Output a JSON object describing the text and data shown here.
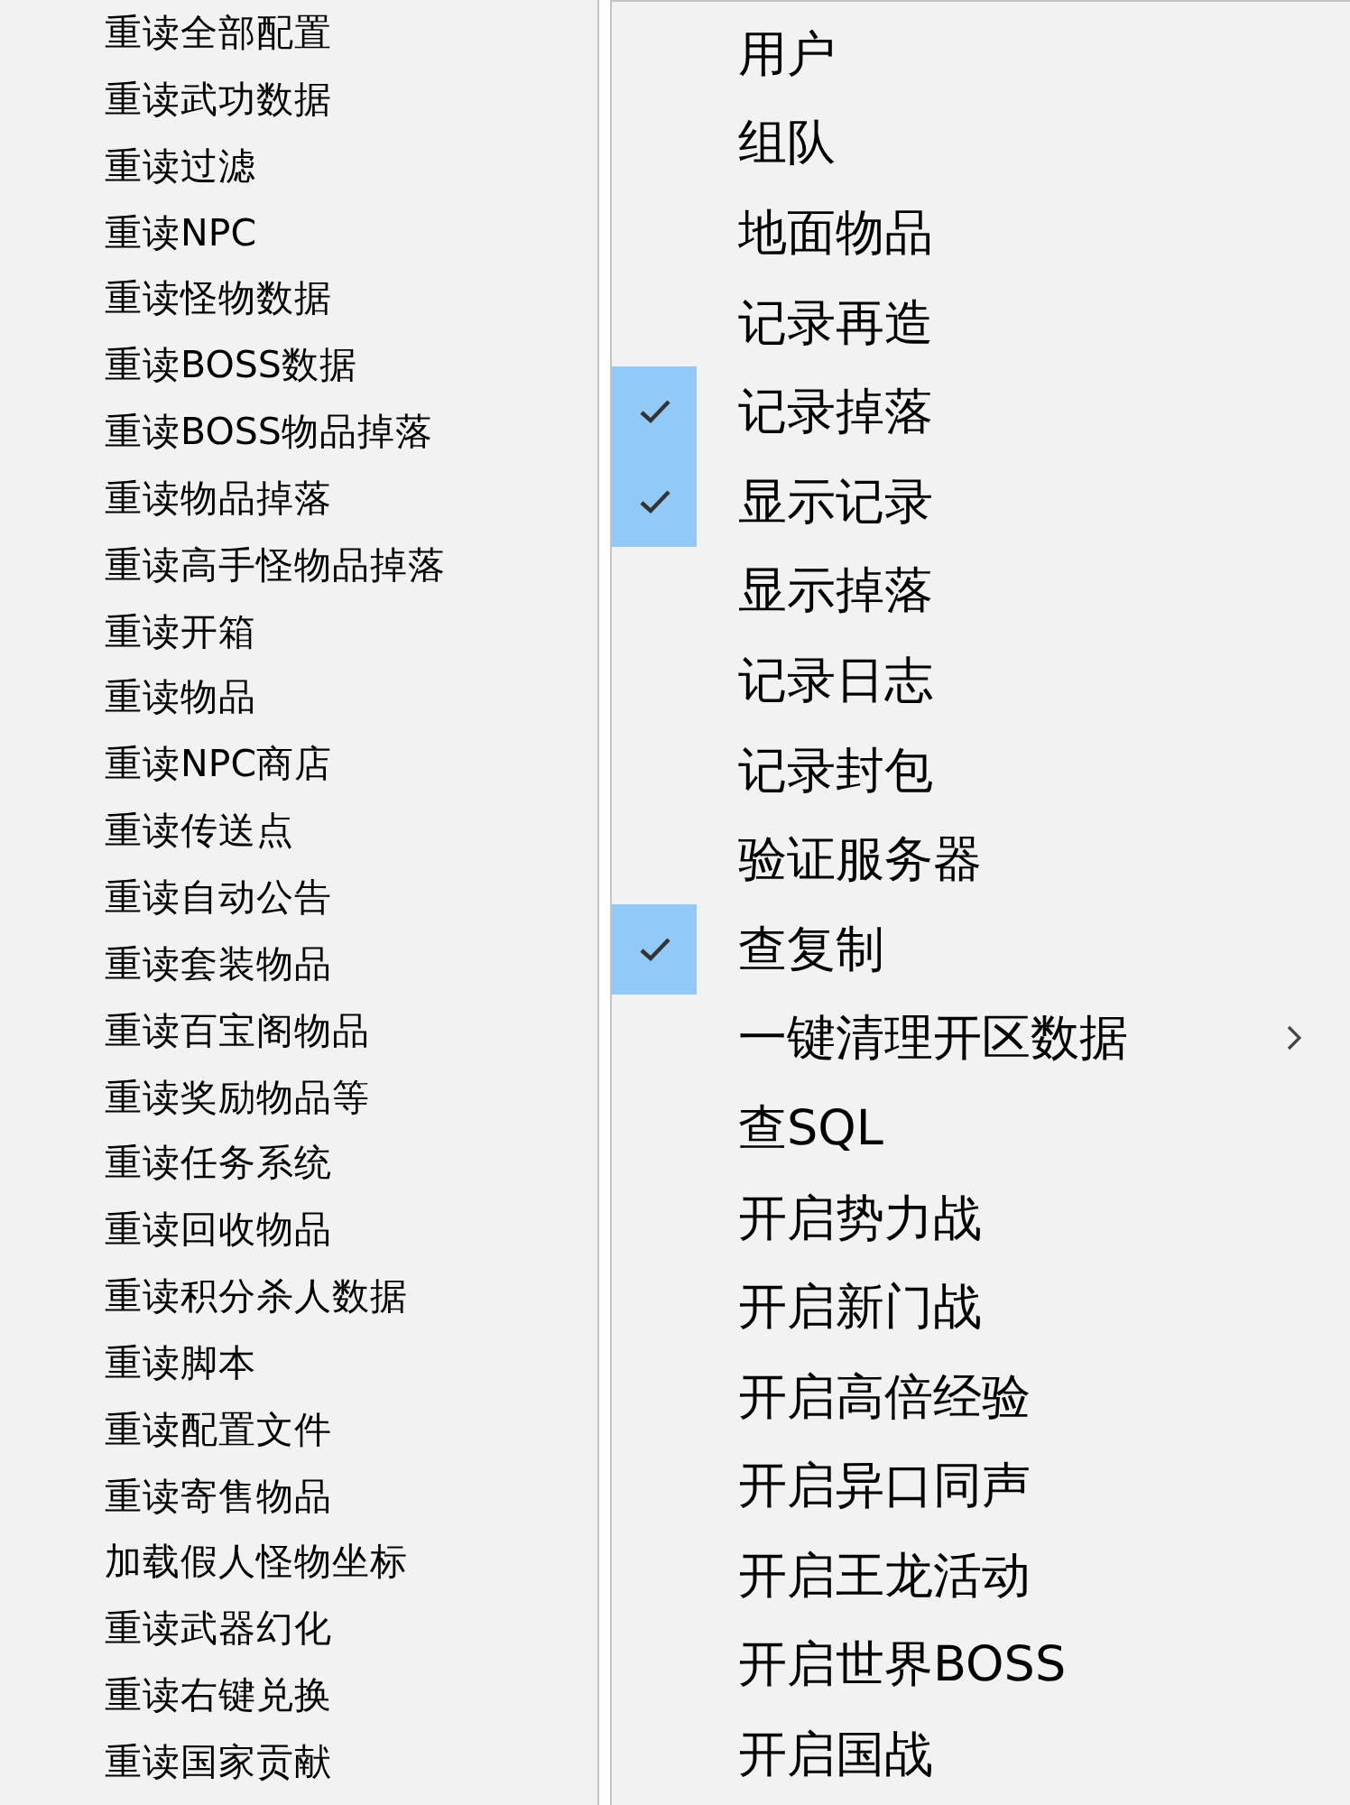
{
  "left_menu": {
    "items": [
      {
        "label": "重读全部配置"
      },
      {
        "label": "重读武功数据"
      },
      {
        "label": "重读过滤"
      },
      {
        "label": "重读NPC"
      },
      {
        "label": "重读怪物数据"
      },
      {
        "label": "重读BOSS数据"
      },
      {
        "label": "重读BOSS物品掉落"
      },
      {
        "label": "重读物品掉落"
      },
      {
        "label": "重读高手怪物品掉落"
      },
      {
        "label": "重读开箱"
      },
      {
        "label": "重读物品"
      },
      {
        "label": "重读NPC商店"
      },
      {
        "label": "重读传送点"
      },
      {
        "label": "重读自动公告"
      },
      {
        "label": "重读套装物品"
      },
      {
        "label": "重读百宝阁物品"
      },
      {
        "label": "重读奖励物品等"
      },
      {
        "label": "重读任务系统"
      },
      {
        "label": "重读回收物品"
      },
      {
        "label": "重读积分杀人数据"
      },
      {
        "label": "重读脚本"
      },
      {
        "label": "重读配置文件"
      },
      {
        "label": "重读寄售物品"
      },
      {
        "label": "加载假人怪物坐标"
      },
      {
        "label": "重读武器幻化"
      },
      {
        "label": "重读右键兑换"
      },
      {
        "label": "重读国家贡献"
      }
    ]
  },
  "right_menu": {
    "items": [
      {
        "label": "用户",
        "checked": false,
        "submenu": false
      },
      {
        "label": "组队",
        "checked": false,
        "submenu": false
      },
      {
        "label": "地面物品",
        "checked": false,
        "submenu": false
      },
      {
        "label": "记录再造",
        "checked": false,
        "submenu": false
      },
      {
        "label": "记录掉落",
        "checked": true,
        "submenu": false
      },
      {
        "label": "显示记录",
        "checked": true,
        "submenu": false
      },
      {
        "label": "显示掉落",
        "checked": false,
        "submenu": false
      },
      {
        "label": "记录日志",
        "checked": false,
        "submenu": false
      },
      {
        "label": "记录封包",
        "checked": false,
        "submenu": false
      },
      {
        "label": "验证服务器",
        "checked": false,
        "submenu": false
      },
      {
        "label": "查复制",
        "checked": true,
        "submenu": false
      },
      {
        "label": "一键清理开区数据",
        "checked": false,
        "submenu": true
      },
      {
        "label": "查SQL",
        "checked": false,
        "submenu": false
      },
      {
        "label": "开启势力战",
        "checked": false,
        "submenu": false
      },
      {
        "label": "开启新门战",
        "checked": false,
        "submenu": false
      },
      {
        "label": "开启高倍经验",
        "checked": false,
        "submenu": false
      },
      {
        "label": "开启异口同声",
        "checked": false,
        "submenu": false
      },
      {
        "label": "开启王龙活动",
        "checked": false,
        "submenu": false
      },
      {
        "label": "开启世界BOSS",
        "checked": false,
        "submenu": false
      },
      {
        "label": "开启国战",
        "checked": false,
        "submenu": false
      }
    ]
  }
}
